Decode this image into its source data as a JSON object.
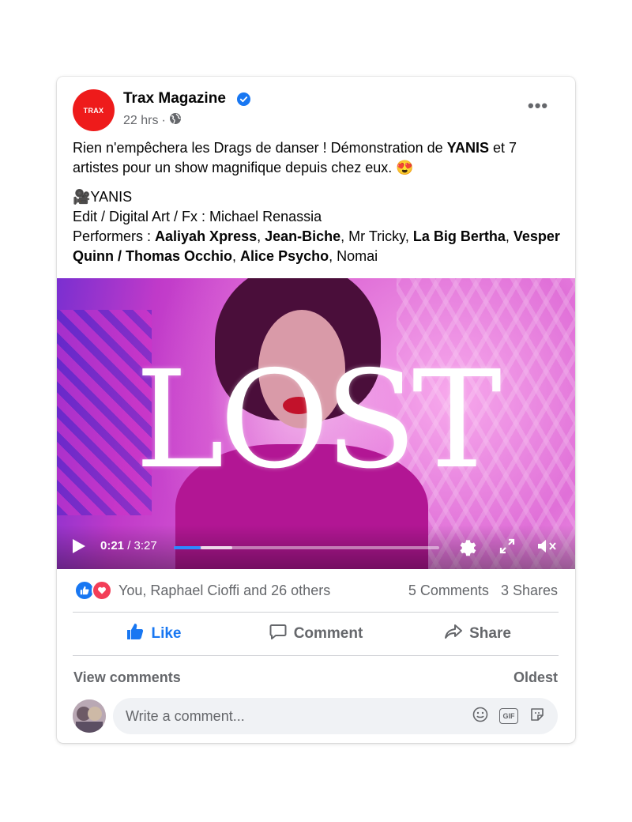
{
  "post": {
    "page_name": "Trax Magazine",
    "avatar_text": "TRAX",
    "time": "22 hrs",
    "dot": "·",
    "text": {
      "line1_a": "Rien n'empêchera les Drags de danser ! Démonstration de ",
      "line1_b": "YANIS",
      "line1_c": " et 7 artistes pour un show magnifique depuis chez eux. ",
      "emoji": "😍",
      "credit_emoji": "🎥",
      "credit_name": "YANIS",
      "edit_line": "Edit / Digital Art / Fx : Michael Renassia",
      "performers_label": "Performers : ",
      "p1": "Aaliyah Xpress",
      "sep1": ", ",
      "p2": "Jean-Biche",
      "sep2": ", Mr Tricky, ",
      "p3": "La Big Bertha",
      "sep3": ", ",
      "p4": "Vesper Quinn / Thomas Occhio",
      "sep4": ", ",
      "p5": "Alice Psycho",
      "sep5": ",  Nomai"
    }
  },
  "video": {
    "overlay_title": "LOST",
    "current_time": "0:21",
    "time_sep": " / ",
    "duration": "3:27",
    "progress_fraction": 0.101,
    "buffered_fraction": 0.22
  },
  "engagement": {
    "reactions_text": "You, Raphael Cioffi and 26 others",
    "comments": "5 Comments",
    "shares": "3 Shares"
  },
  "actions": {
    "like": "Like",
    "comment": "Comment",
    "share": "Share"
  },
  "comments": {
    "view": "View comments",
    "sort": "Oldest",
    "placeholder": "Write a comment...",
    "gif_label": "GIF"
  },
  "colors": {
    "brand_red": "#ee1b1b",
    "accent_blue": "#1877f2",
    "love_red": "#f33e58"
  }
}
